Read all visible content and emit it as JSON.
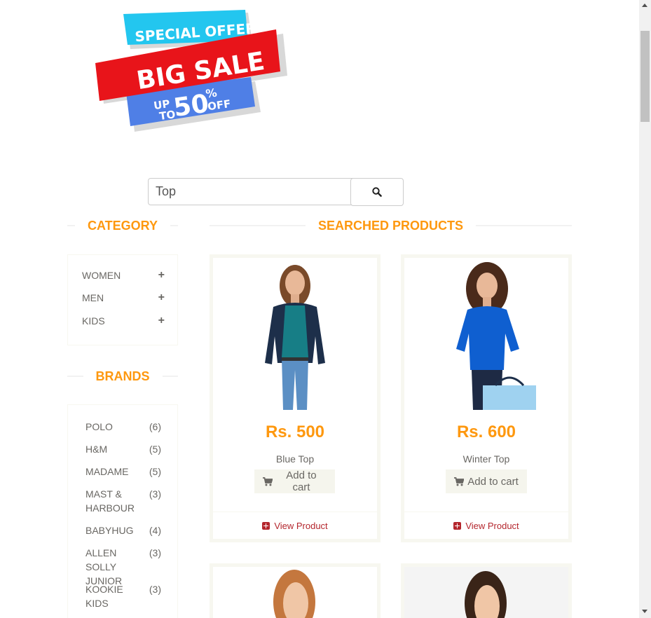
{
  "banner": {
    "line1": "SPECIAL OFFER",
    "line2": "BIG SALE",
    "line3_up": "UP",
    "line3_to": "TO",
    "line3_pct": "50",
    "line3_sym": "%",
    "line3_off": "OFF"
  },
  "search": {
    "value": "Top",
    "button_icon": "search-icon"
  },
  "sidebar": {
    "category_title": "Category",
    "categories": [
      {
        "label": "Women",
        "icon": "plus-icon"
      },
      {
        "label": "Men",
        "icon": "plus-icon"
      },
      {
        "label": "Kids",
        "icon": "plus-icon"
      }
    ],
    "brands_title": "Brands",
    "brands": [
      {
        "name": "Polo",
        "count": "(6)"
      },
      {
        "name": "H&M",
        "count": "(5)"
      },
      {
        "name": "Madame",
        "count": "(5)"
      },
      {
        "name": "Mast & Harbour",
        "count": "(3)"
      },
      {
        "name": "Babyhug",
        "count": "(4)"
      },
      {
        "name": "Allen Solly Junior",
        "count": "(3)"
      },
      {
        "name": "Kookie Kids",
        "count": "(3)"
      }
    ]
  },
  "main": {
    "title": "Searched Products",
    "products": [
      {
        "price": "Rs. 500",
        "name": "Blue Top",
        "cart_label": "Add to cart",
        "view_label": "View Product"
      },
      {
        "price": "Rs. 600",
        "name": "Winter Top",
        "cart_label": "Add to cart",
        "view_label": "View Product"
      }
    ]
  },
  "colors": {
    "accent": "#fe980f",
    "text": "#696763",
    "view_link": "#b4262d",
    "banner_red": "#e8141a",
    "banner_cyan": "#23c6ef",
    "banner_blue": "#4f7fe6"
  }
}
